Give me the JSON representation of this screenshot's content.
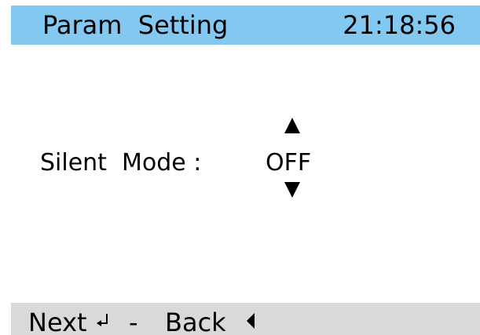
{
  "header": {
    "title": "Param  Setting",
    "time": "21:18:56",
    "background": "#82c8f0"
  },
  "param": {
    "label": "Silent  Mode :",
    "value": "OFF",
    "up_icon": "arrow-up-icon",
    "down_icon": "arrow-down-icon"
  },
  "footer": {
    "next_label": "Next",
    "enter_icon": "enter-icon",
    "separator": "-",
    "back_label": "Back",
    "back_icon": "back-triangle-icon",
    "background": "#d9d9d9"
  }
}
